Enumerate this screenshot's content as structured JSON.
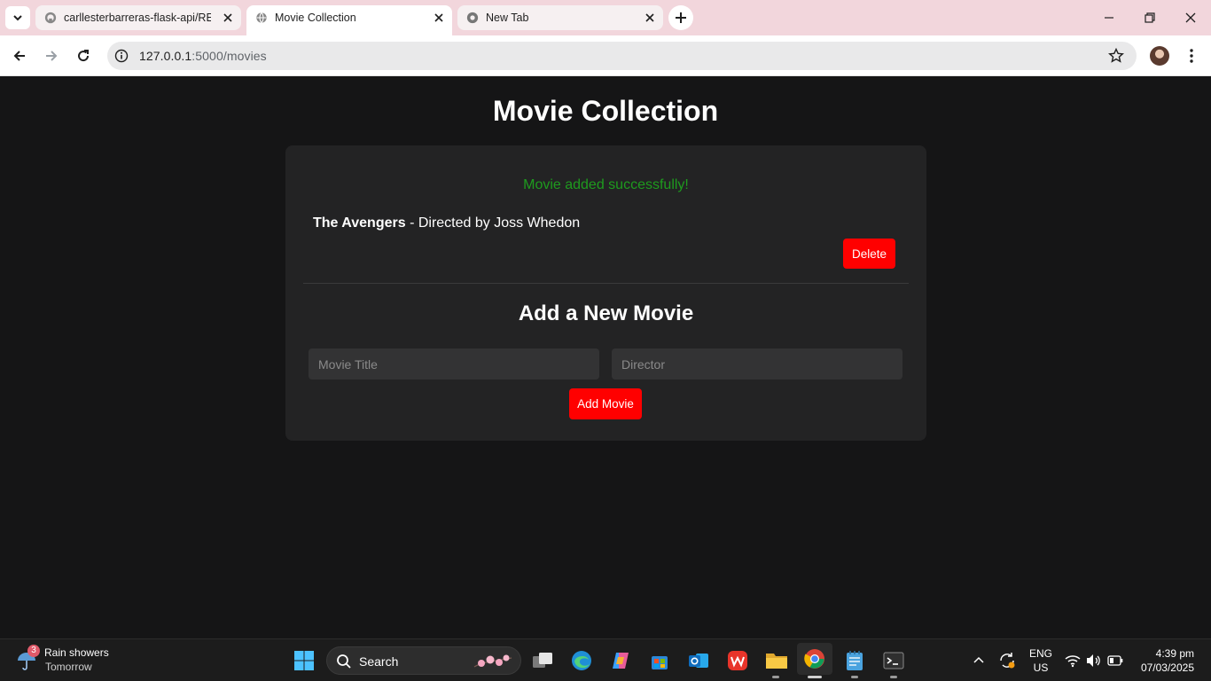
{
  "browser": {
    "tabs": [
      {
        "title": "carllesterbarreras-flask-api/README",
        "active": false
      },
      {
        "title": "Movie Collection",
        "active": true
      },
      {
        "title": "New Tab",
        "active": false
      }
    ],
    "url_host": "127.0.0.1",
    "url_path": ":5000/movies"
  },
  "page": {
    "title": "Movie Collection",
    "flash_message": "Movie added successfully!",
    "movies": [
      {
        "title": "The Avengers",
        "details": " - Directed by Joss Whedon",
        "delete_label": "Delete"
      }
    ],
    "form": {
      "heading": "Add a New Movie",
      "title_placeholder": "Movie Title",
      "director_placeholder": "Director",
      "submit_label": "Add Movie"
    },
    "colors": {
      "accent": "#ff0000",
      "success": "#1e9b1e",
      "background": "#151516",
      "card": "#232324"
    }
  },
  "taskbar": {
    "weather_title": "Rain showers",
    "weather_sub": "Tomorrow",
    "weather_badge": "3",
    "search_label": "Search",
    "lang_top": "ENG",
    "lang_bottom": "US",
    "time": "4:39 pm",
    "date": "07/03/2025"
  }
}
